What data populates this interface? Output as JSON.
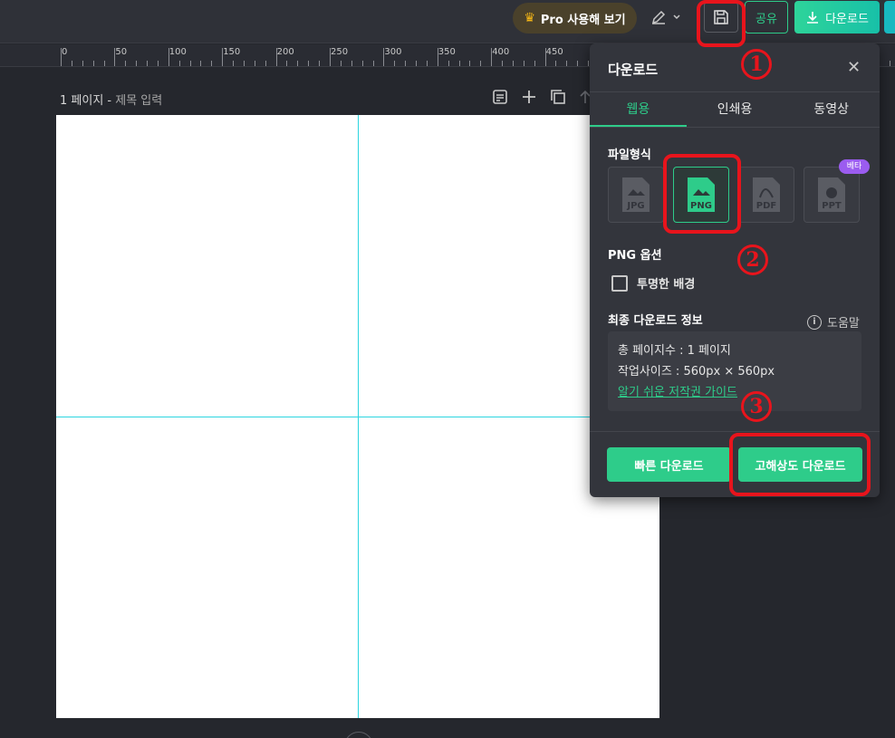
{
  "topbar": {
    "pro_label": "Pro 사용해 보기",
    "share_label": "공유",
    "download_label": "다운로드"
  },
  "ruler": {
    "labels": [
      "0",
      "50",
      "100",
      "150",
      "200",
      "250",
      "300",
      "350",
      "400",
      "450"
    ]
  },
  "page": {
    "number_label": "1 페이지 -",
    "title_placeholder": "제목 입력"
  },
  "panel": {
    "title": "다운로드",
    "tabs": [
      {
        "label": "웹용",
        "active": true
      },
      {
        "label": "인쇄용",
        "active": false
      },
      {
        "label": "동영상",
        "active": false
      }
    ],
    "format_label": "파일형식",
    "formats": [
      "JPG",
      "PNG",
      "PDF",
      "PPT"
    ],
    "selected_format": "PNG",
    "beta_label": "베타",
    "png_options_label": "PNG 옵션",
    "transparent_label": "투명한 배경",
    "final_info_label": "최종 다운로드 정보",
    "help_label": "도움말",
    "info_pages": "총 페이지수 : 1 페이지",
    "info_size": "작업사이즈 : 560px × 560px",
    "info_link": "알기 쉬운 저작권 가이드",
    "quick_download": "빠른 다운로드",
    "hires_download": "고해상도 다운로드"
  },
  "annotations": {
    "step1": "1",
    "step2": "2",
    "step3": "3"
  },
  "colors": {
    "accent": "#2ecc8a",
    "annotation": "#e8141c",
    "guide": "#2cd5e0"
  }
}
